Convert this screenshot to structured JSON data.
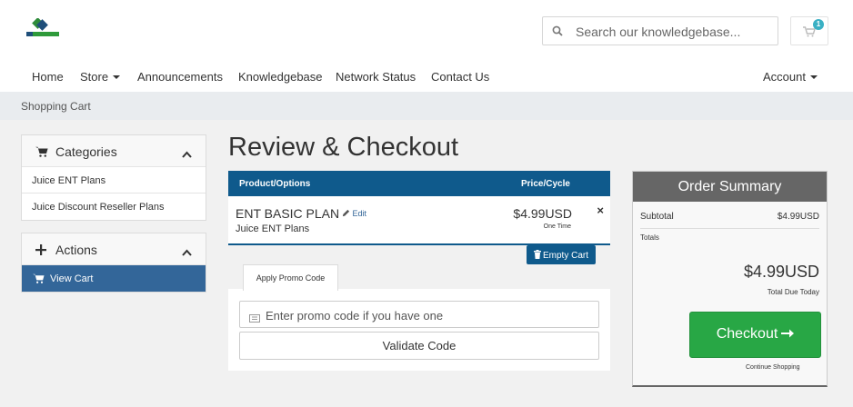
{
  "header": {
    "search_placeholder": "Search our knowledgebase...",
    "cart_count": "1"
  },
  "nav": {
    "home": "Home",
    "store": "Store",
    "announcements": "Announcements",
    "knowledgebase": "Knowledgebase",
    "network_status": "Network Status",
    "contact_us": "Contact Us",
    "account": "Account"
  },
  "breadcrumb": "Shopping Cart",
  "sidebar": {
    "categories": {
      "title": "Categories",
      "items": [
        "Juice ENT Plans",
        "Juice Discount Reseller Plans"
      ]
    },
    "actions": {
      "title": "Actions",
      "items": [
        "View Cart"
      ]
    }
  },
  "page_title": "Review & Checkout",
  "cart": {
    "col_product": "Product/Options",
    "col_price": "Price/Cycle",
    "items": [
      {
        "name": "ENT BASIC PLAN",
        "edit_label": "Edit",
        "group": "Juice ENT Plans",
        "price": "$4.99USD",
        "cycle": "One Time",
        "remove_label": "×"
      }
    ],
    "empty_cart_label": "Empty Cart"
  },
  "promo": {
    "tab_label": "Apply Promo Code",
    "placeholder": "Enter promo code if you have one",
    "validate_label": "Validate Code"
  },
  "summary": {
    "title": "Order Summary",
    "subtotal_label": "Subtotal",
    "subtotal_value": "$4.99USD",
    "totals_label": "Totals",
    "total_value": "$4.99USD",
    "total_due_label": "Total Due Today",
    "checkout_label": "Checkout",
    "continue_label": "Continue Shopping"
  },
  "colors": {
    "primary": "#0f5a8c",
    "sidebar_active": "#336699",
    "checkout_green": "#28a745",
    "summary_header": "#666666",
    "badge": "#3ab0c4"
  }
}
